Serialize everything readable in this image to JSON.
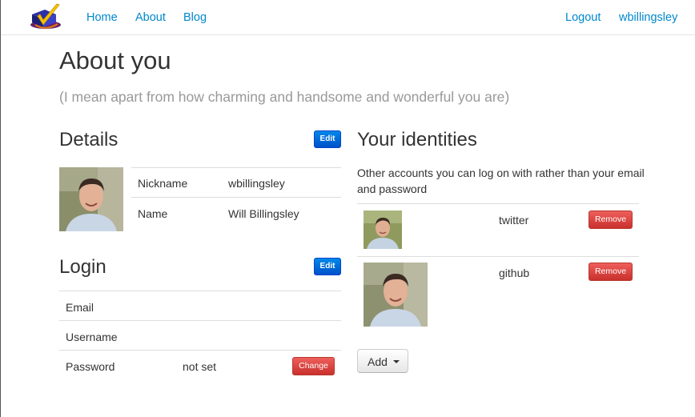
{
  "nav": {
    "left_links": [
      "Home",
      "About",
      "Blog"
    ],
    "right_links": [
      "Logout",
      "wbillingsley"
    ]
  },
  "page": {
    "title": "About you",
    "subtitle": "(I mean apart from how charming and handsome and wonderful you are)"
  },
  "details": {
    "title": "Details",
    "edit_label": "Edit",
    "rows": [
      {
        "label": "Nickname",
        "value": "wbillingsley"
      },
      {
        "label": "Name",
        "value": "Will Billingsley"
      }
    ]
  },
  "login": {
    "title": "Login",
    "edit_label": "Edit",
    "rows": [
      {
        "label": "Email",
        "value": ""
      },
      {
        "label": "Username",
        "value": ""
      },
      {
        "label": "Password",
        "value": "not set",
        "action": "Change"
      }
    ]
  },
  "identities": {
    "title": "Your identities",
    "description": "Other accounts you can log on with rather than your email and password",
    "items": [
      {
        "service": "twitter",
        "action": "Remove"
      },
      {
        "service": "github",
        "action": "Remove"
      }
    ],
    "add_label": "Add"
  },
  "colors": {
    "link": "#0088cc",
    "primary_button": "#0066d6",
    "danger_button": "#d9534f",
    "subtitle_gray": "#999999"
  }
}
